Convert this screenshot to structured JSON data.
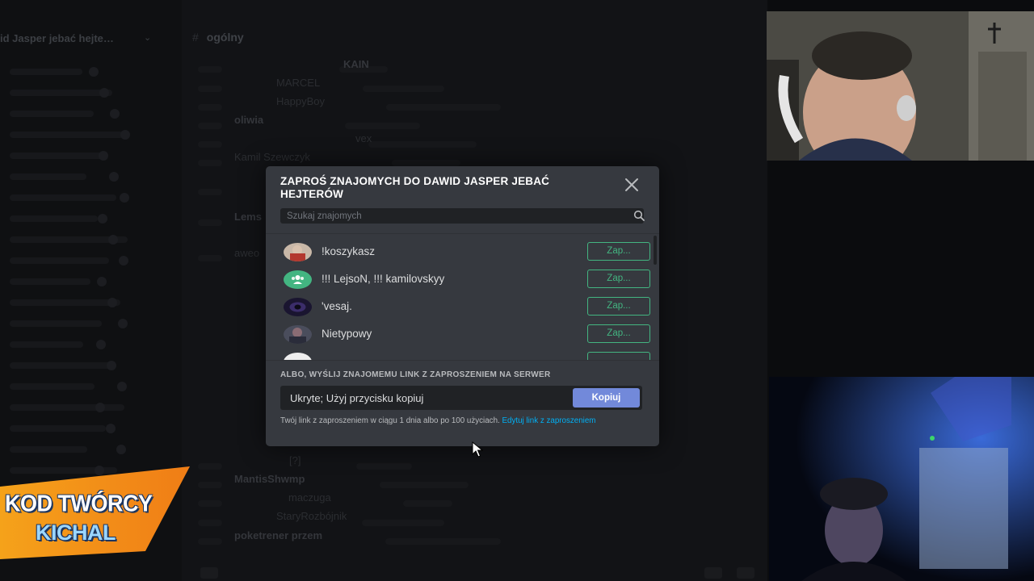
{
  "background": {
    "server_name": "id Jasper jebać hejte…",
    "channel_name": "ogólny",
    "member_names": [
      "KAIN",
      "MARCEL",
      "HappyBoy",
      "oliwia",
      "vex",
      "Kamil Szewczyk",
      "Lems",
      "aweo",
      "[?]",
      "MantisShwmp",
      "maczuga",
      "StaryRozbójnik",
      "poketrener przem"
    ]
  },
  "modal": {
    "title": "ZAPROŚ ZNAJOMYCH DO DAWID JASPER JEBAĆ HEJTERÓW",
    "search_placeholder": "Szukaj znajomych",
    "friends": [
      {
        "name": "!koszykasz",
        "button": "Zap...",
        "avatar": "photo-avatar"
      },
      {
        "name": "!!! LejsoN, !!! kamilovskyy",
        "button": "Zap...",
        "avatar": "group-dm-icon"
      },
      {
        "name": "'vesaj.",
        "button": "Zap...",
        "avatar": "dark-avatar"
      },
      {
        "name": "Nietypowy",
        "button": "Zap...",
        "avatar": "photo-avatar"
      }
    ],
    "or_label": "ALBO, WYŚLIJ ZNAJOMEMU LINK Z ZAPROSZENIEM NA SERWER",
    "link_value": "Ukryte; Użyj przycisku kopiuj",
    "copy_label": "Kopiuj",
    "expiry_note": "Twój link z zaproszeniem w ciągu 1 dnia albo po 100 użyciach.",
    "edit_link": "Edytuj link z zaproszeniem"
  },
  "creator_code": {
    "line1": "KOD TWÓRCY",
    "line2": "KICHAL"
  },
  "colors": {
    "modal_bg": "#36393f",
    "input_bg": "#202225",
    "invite_green": "#43b581",
    "blurple": "#7289da",
    "link_blue": "#00b0f4",
    "banner_orange": "#f5a21a"
  }
}
